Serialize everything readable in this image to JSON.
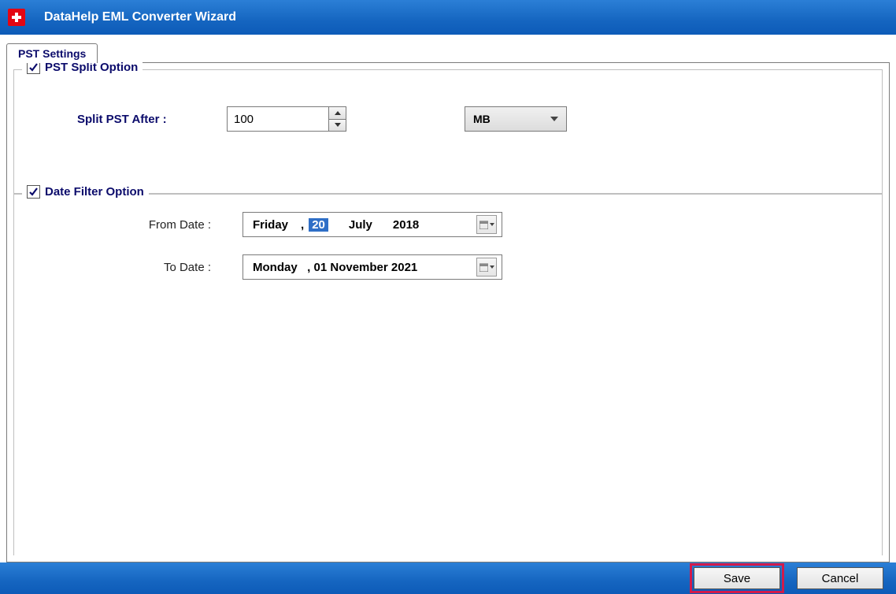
{
  "titlebar": {
    "title": "DataHelp EML Converter Wizard"
  },
  "tab": {
    "label": "PST Settings"
  },
  "splitGroup": {
    "legend": "PST Split Option",
    "checked": true,
    "fieldLabel": "Split PST After :",
    "value": "100",
    "unit": "MB"
  },
  "dateGroup": {
    "legend": "Date Filter Option",
    "checked": true,
    "fromLabel": "From Date    :",
    "toLabel": "To Date    :",
    "from": {
      "weekday": "Friday",
      "comma": ",",
      "day": "20",
      "month": "July",
      "year": "2018"
    },
    "to": {
      "text": "Monday   , 01 November 2021"
    }
  },
  "footer": {
    "save": "Save",
    "cancel": "Cancel"
  }
}
